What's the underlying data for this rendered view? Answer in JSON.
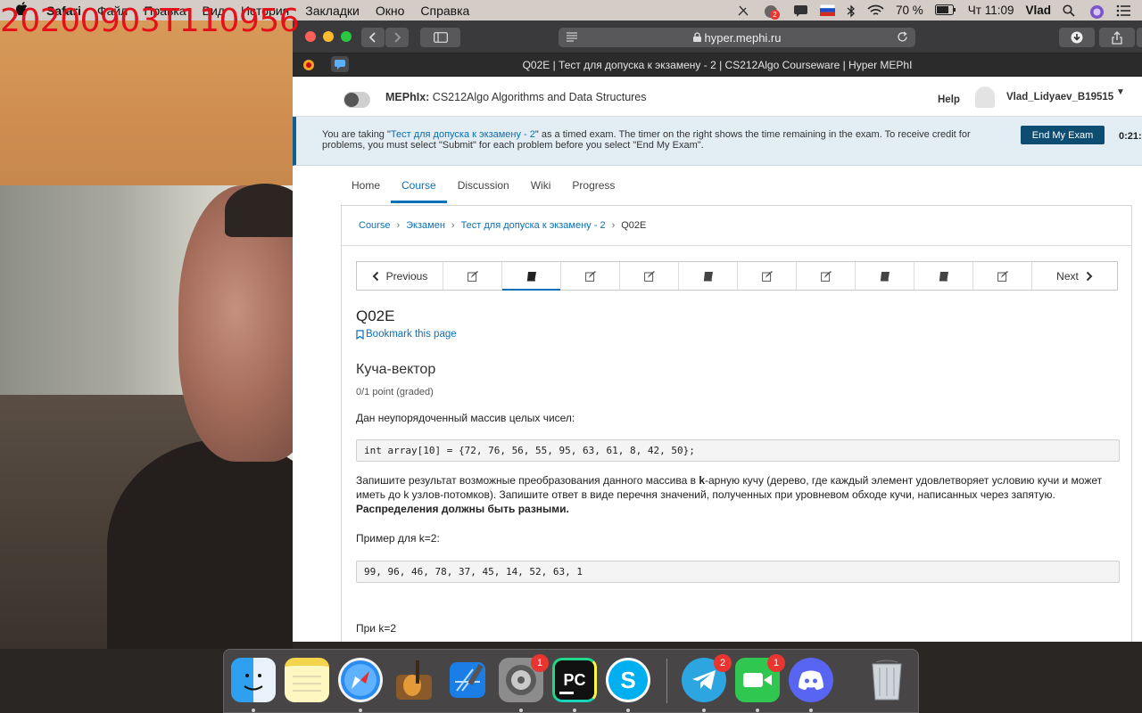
{
  "watermark": "20200903T110956",
  "menubar": {
    "items": [
      "Safari",
      "Файл",
      "Правка",
      "Вид",
      "История",
      "Закладки",
      "Окно",
      "Справка"
    ],
    "battery": "70 %",
    "clock": "Чт 11:09",
    "user": "Vlad",
    "notif_badge": "2"
  },
  "browser": {
    "url": "hyper.mephi.ru",
    "tab_title": "Q02E | Тест для допуска к экзамену - 2 | CS212Algo Courseware | Hyper MEPhI"
  },
  "header": {
    "brand_org": "MEPhIx:",
    "brand_course": "CS212Algo Algorithms and Data Structures",
    "help": "Help",
    "username": "Vlad_Lidyaev_B19515"
  },
  "exam_banner": {
    "prefix": "You are taking \"",
    "exam_link": "Тест для допуска к экзамену - 2",
    "suffix": "\" as a timed exam. The timer on the right shows the time remaining in the exam. To receive credit for problems, you must select \"Submit\" for each problem before you select \"End My Exam\".",
    "end_button": "End My Exam",
    "timer": "0:21:"
  },
  "course_tabs": [
    "Home",
    "Course",
    "Discussion",
    "Wiki",
    "Progress"
  ],
  "breadcrumb": [
    "Course",
    "Экзамен",
    "Тест для допуска к экзамену - 2",
    "Q02E"
  ],
  "sequence_nav": {
    "previous": "Previous",
    "next": "Next",
    "units": [
      "edit-icon",
      "book-icon",
      "edit-icon",
      "edit-icon",
      "book-icon",
      "edit-icon",
      "edit-icon",
      "book-icon",
      "book-icon",
      "edit-icon"
    ],
    "active_index": 1
  },
  "unit": {
    "title": "Q02E",
    "bookmark": "Bookmark this page",
    "problem_title": "Куча-вектор",
    "points": "0/1 point (graded)",
    "intro": "Дан неупорядоченный массив целых чисел:",
    "code": "int array[10] = {72, 76, 56, 55, 95, 63, 61, 8, 42, 50};",
    "task_a": "Запишите результат возможные преобразования данного массива в ",
    "task_k": "k",
    "task_b": "-арную кучу (дерево, где каждый элемент удовлетворяет условию кучи и может иметь до k узлов-потомков). Запишите ответ в виде перечня значений, полученных при уровневом обходе кучи, написанных через запятую. ",
    "task_bold": "Распределения должны быть разными.",
    "example_label": "Пример для k=2:",
    "example": "99, 96, 46, 78, 37, 45, 14, 52, 63, 1",
    "answer_label": "При k=2"
  },
  "dock": {
    "apps": [
      "finder-icon",
      "notes-icon",
      "safari-icon",
      "garageband-icon",
      "xcode-icon",
      "system-preferences-icon",
      "pycharm-icon",
      "skype-icon",
      "telegram-icon",
      "facetime-icon",
      "discord-icon",
      "trash-icon"
    ],
    "badges": {
      "system_preferences": "1",
      "telegram": "2",
      "facetime": "1"
    }
  }
}
